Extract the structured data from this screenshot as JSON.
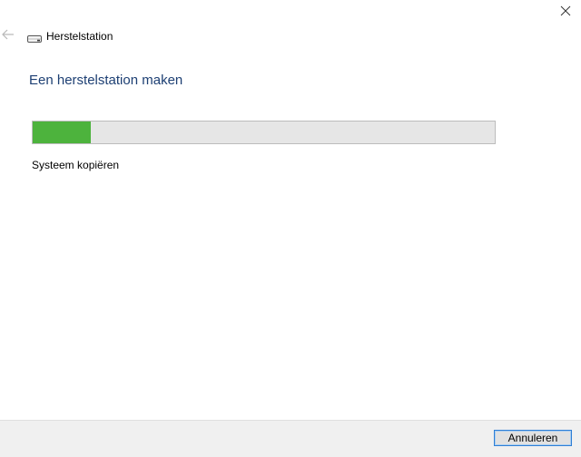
{
  "window": {
    "title": "Herstelstation",
    "icons": {
      "close": "close-icon",
      "back": "back-arrow-icon",
      "drive": "drive-icon"
    }
  },
  "main": {
    "heading": "Een herstelstation maken",
    "progress": {
      "fraction": 0.125,
      "status": "Systeem kopiëren"
    }
  },
  "footer": {
    "cancel_label": "Annuleren"
  },
  "colors": {
    "heading": "#1d3f73",
    "progress_fill": "#4db33d",
    "progress_track": "#e6e6e6",
    "footer_bg": "#f0f0f0",
    "button_border": "#2f7fd6"
  }
}
